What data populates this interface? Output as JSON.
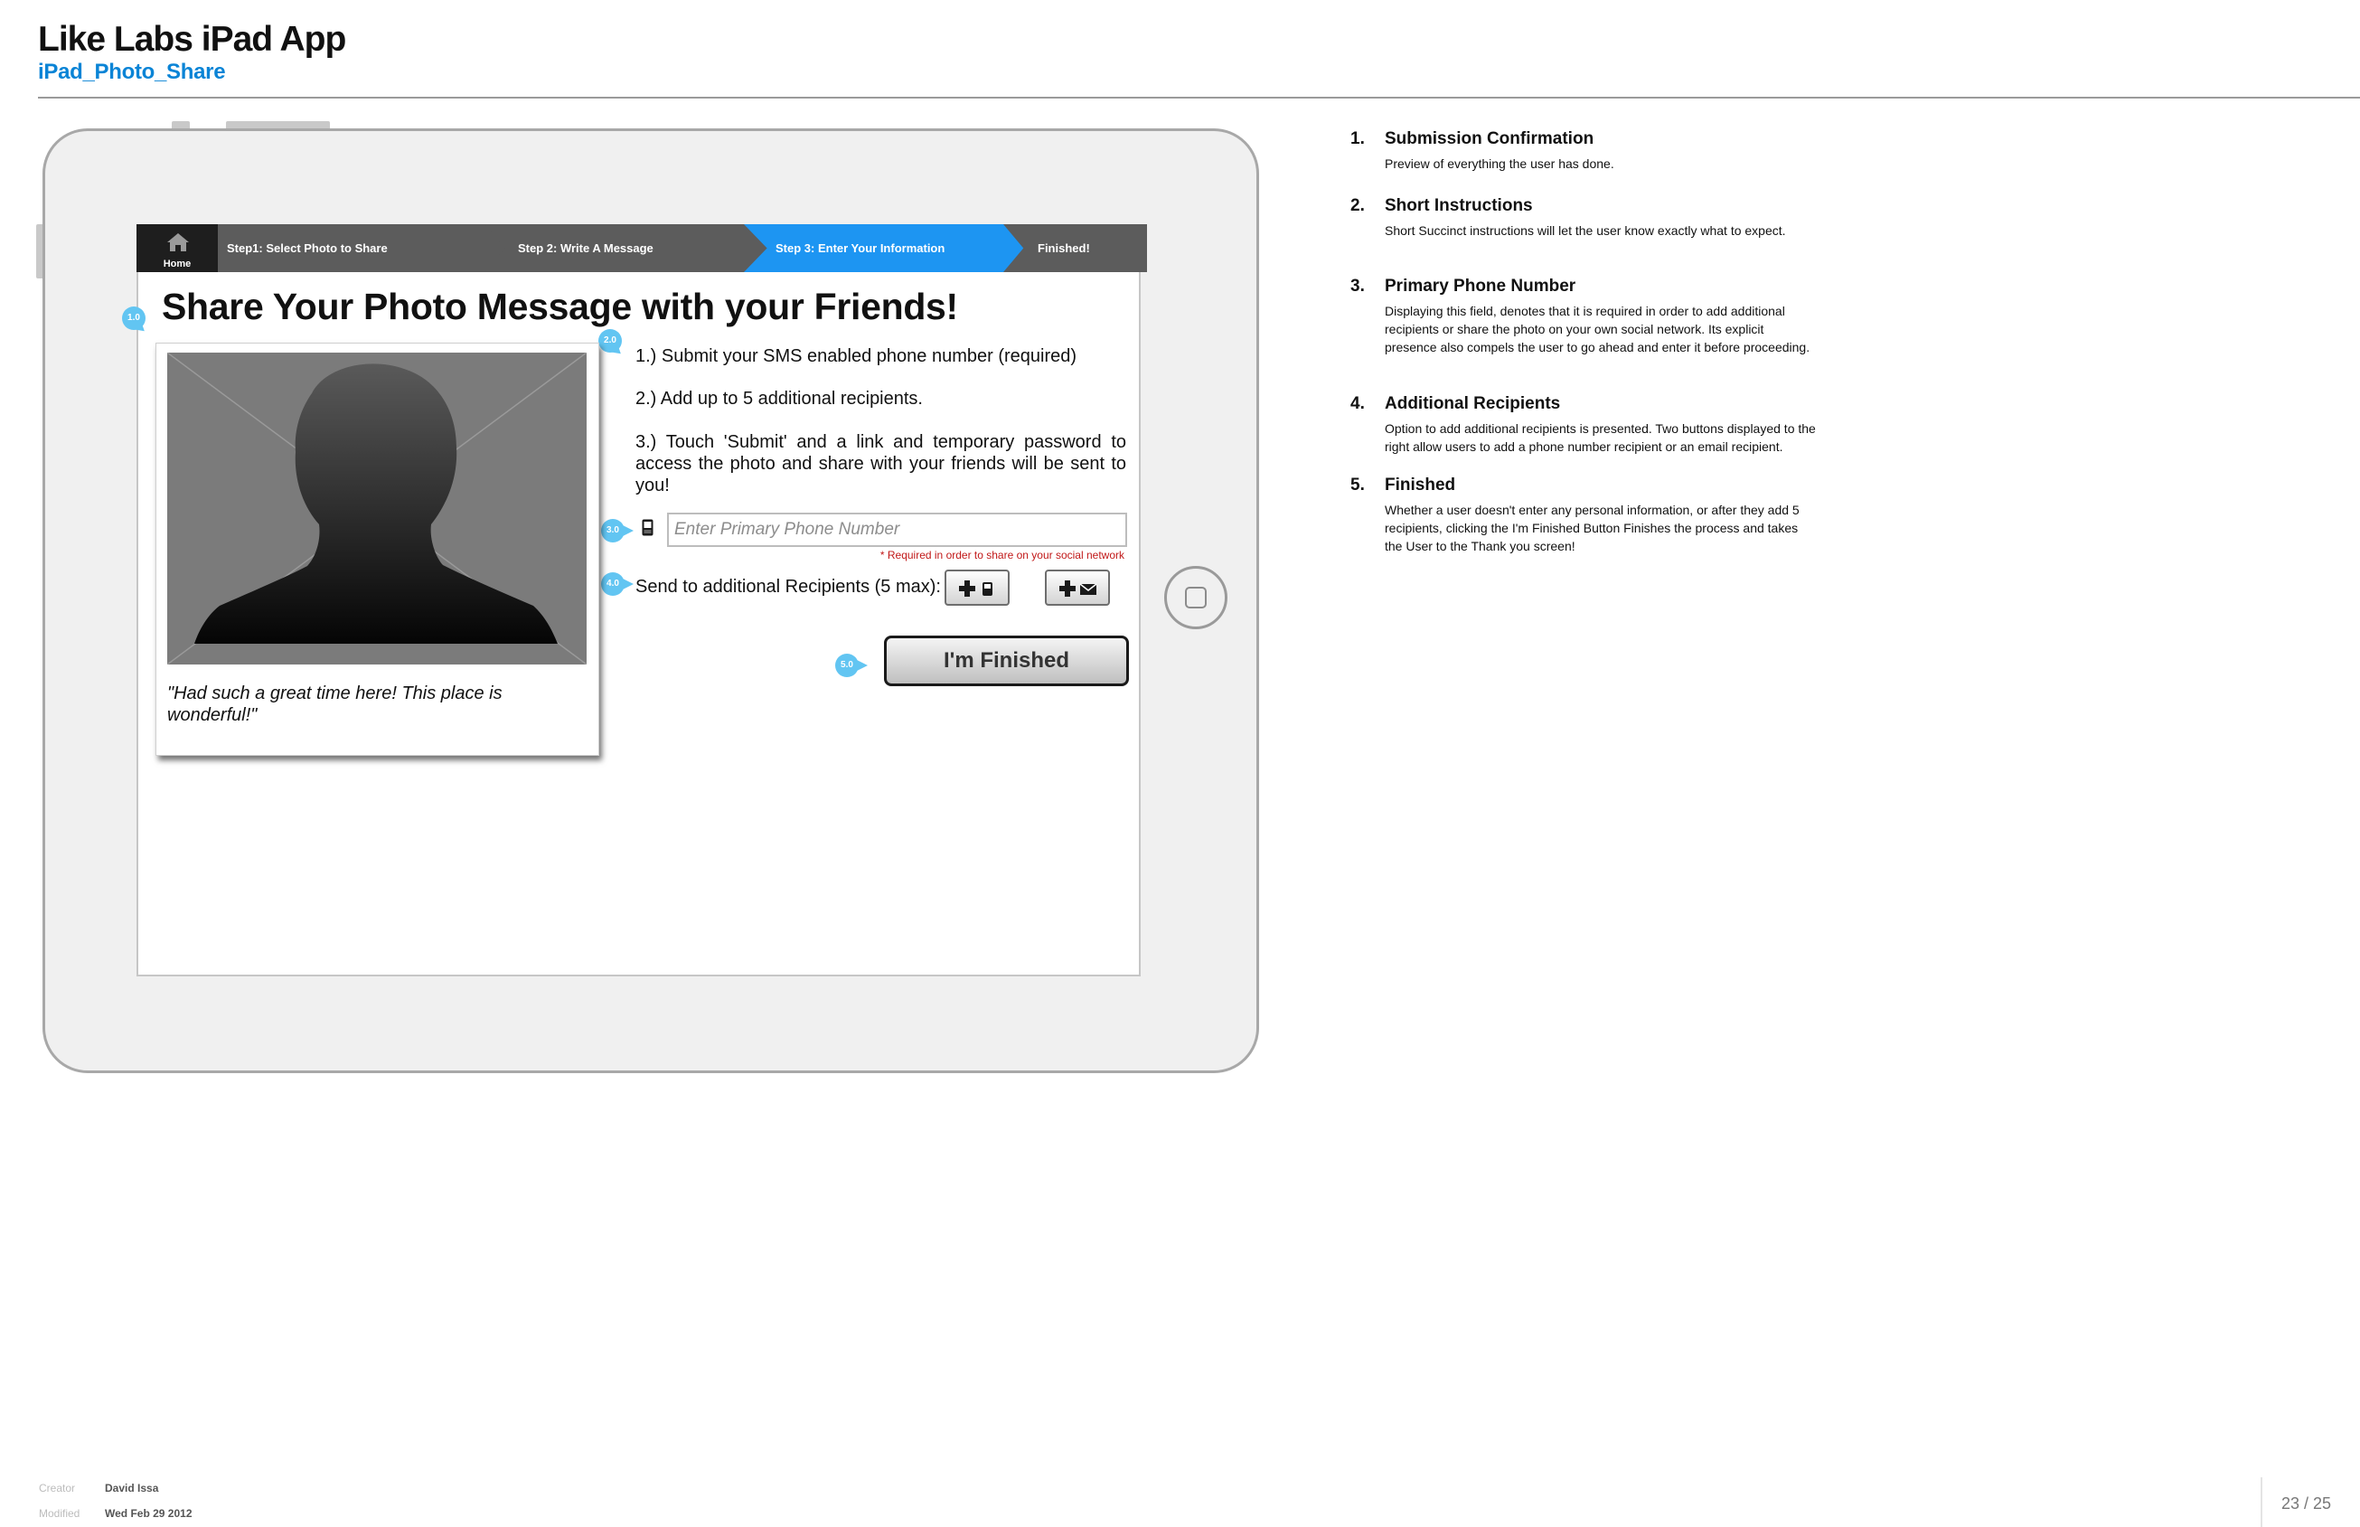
{
  "header": {
    "title": "Like Labs iPad App",
    "subtitle": "iPad_Photo_Share"
  },
  "nav": {
    "home_label": "Home",
    "steps": [
      {
        "label": "Step1: Select Photo to Share",
        "active": false
      },
      {
        "label": "Step 2:  Write A Message",
        "active": false
      },
      {
        "label": "Step 3:  Enter Your Information",
        "active": true
      },
      {
        "label": "Finished!",
        "active": false
      }
    ]
  },
  "page": {
    "title": "Share Your Photo Message with your Friends!",
    "photo_caption": "\"Had such a great time here! This place is wonderful!\"",
    "instructions": [
      "1.) Submit your SMS enabled phone number (required)",
      "2.) Add up to 5 additional recipients.",
      "3.) Touch 'Submit' and a link and temporary password to access the photo and share with your friends will be sent to you!"
    ],
    "phone_placeholder": "Enter Primary Phone Number",
    "phone_value": "",
    "required_note": "* Required in order to share on your social network",
    "recipients_label": "Send to additional Recipients (5 max):",
    "finished_label": "I'm Finished"
  },
  "callouts": [
    "1.0",
    "2.0",
    "3.0",
    "4.0",
    "5.0"
  ],
  "notes": [
    {
      "num": "1.",
      "title": "Submission Confirmation",
      "desc": "Preview of everything the user has done."
    },
    {
      "num": "2.",
      "title": "Short Instructions",
      "desc": "Short Succinct instructions will let the user know exactly what to expect."
    },
    {
      "num": "3.",
      "title": "Primary Phone Number",
      "desc": "Displaying this field, denotes that it is required in order to add additional recipients or share the photo on your own social network. Its explicit presence also compels the user to go ahead and enter it before proceeding."
    },
    {
      "num": "4.",
      "title": "Additional Recipients",
      "desc": "Option to add additional recipients is presented. Two buttons displayed to the right allow users to add a phone number recipient or an email recipient."
    },
    {
      "num": "5.",
      "title": "Finished",
      "desc": "Whether a user doesn't enter any personal information, or after they add 5 recipients, clicking the I'm Finished Button Finishes the process and takes the User to the Thank you screen!"
    }
  ],
  "footer": {
    "creator_label": "Creator",
    "creator": "David Issa",
    "modified_label": "Modified",
    "modified": "Wed Feb 29 2012",
    "page_counter": "23 / 25"
  },
  "colors": {
    "accent_blue": "#1d95f2",
    "subtitle_blue": "#0a84d6",
    "callout_blue": "#62c5f2",
    "required_red": "#c11818"
  },
  "icons": {
    "home": "house-icon",
    "phone": "mobile-phone-icon",
    "add_phone": "add-phone-icon",
    "add_email": "add-email-icon",
    "ipad_home": "ipad-home-button"
  }
}
